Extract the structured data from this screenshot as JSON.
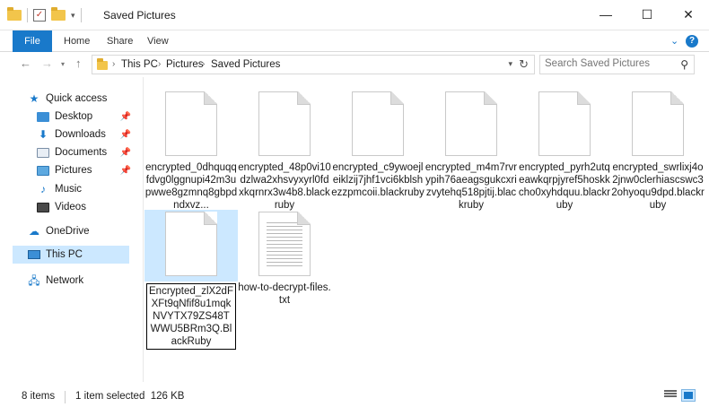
{
  "window": {
    "title": "Saved Pictures",
    "controls": {
      "minimize": "—",
      "maximize": "☐",
      "close": "✕"
    }
  },
  "ribbon": {
    "tabs": [
      "File",
      "Home",
      "Share",
      "View"
    ]
  },
  "address": {
    "crumbs": [
      "This PC",
      "Pictures",
      "Saved Pictures"
    ],
    "search_placeholder": "Search Saved Pictures"
  },
  "sidebar": {
    "quick_access": "Quick access",
    "items": [
      {
        "label": "Desktop",
        "icon": "desktop-icon",
        "pinned": true
      },
      {
        "label": "Downloads",
        "icon": "downloads-icon",
        "pinned": true
      },
      {
        "label": "Documents",
        "icon": "documents-icon",
        "pinned": true
      },
      {
        "label": "Pictures",
        "icon": "pictures-icon",
        "pinned": true
      },
      {
        "label": "Music",
        "icon": "music-icon",
        "pinned": false
      },
      {
        "label": "Videos",
        "icon": "videos-icon",
        "pinned": false
      }
    ],
    "onedrive": "OneDrive",
    "this_pc": "This PC",
    "network": "Network"
  },
  "files": [
    {
      "name": "encrypted_0dhquqqfdvg0lggnupi42m3upwwe8gzmnq8gbpdndxvz...",
      "type": "doc",
      "selected": false
    },
    {
      "name": "encrypted_48p0vi10dzlwa2xhsvyxyrl0fdxkqrnrx3w4b8.blackruby",
      "type": "doc",
      "selected": false
    },
    {
      "name": "encrypted_c9ywoejleiklzij7jhf1vci6kblshezzpmcoii.blackruby",
      "type": "doc",
      "selected": false
    },
    {
      "name": "encrypted_m4m7rvrypih76aeagsgukcxrizvytehq518pjtij.blackruby",
      "type": "doc",
      "selected": false
    },
    {
      "name": "encrypted_pyrh2utqeawkqrpjyref5hoskkcho0xyhdquu.blackruby",
      "type": "doc",
      "selected": false
    },
    {
      "name": "encrypted_swrlixj4o2jnw0clerhiascswc32ohyoqu9dpd.blackruby",
      "type": "doc",
      "selected": false
    },
    {
      "name": "Encrypted_zlX2dFXFt9qNfif8u1mqkNVYTX79ZS48TWWU5BRm3Q.BlackRuby",
      "type": "doc",
      "selected": true
    },
    {
      "name": "how-to-decrypt-files.txt",
      "type": "txt",
      "selected": false
    }
  ],
  "status": {
    "count": "8 items",
    "selection": "1 item selected  126 KB"
  },
  "colors": {
    "accent": "#1979ca",
    "selection": "#cce8ff"
  }
}
